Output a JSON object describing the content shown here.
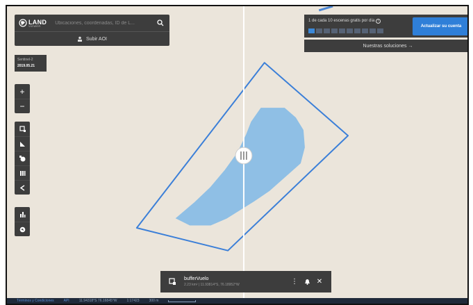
{
  "app": {
    "logo_text": "LAND",
    "logo_subtext": "VIEWER"
  },
  "search": {
    "placeholder": "Ubicaciones, coordenadas, ID de L...",
    "icon": "search-icon",
    "upload_label": "Subir AOI"
  },
  "scene": {
    "satellite": "Sentinel-2",
    "date": "2019.05.21"
  },
  "toolbar": {
    "zoom": [
      "zoom-in-icon",
      "zoom-out-icon"
    ],
    "tools": [
      "aoi-select-icon",
      "measure-icon",
      "time-lapse-icon",
      "compare-icon",
      "share-icon"
    ],
    "analytics": [
      "chart-icon",
      "globe-icon"
    ]
  },
  "quota": {
    "text": "1 de cada 10 escenas gratis por día",
    "used": 1,
    "total": 10,
    "upgrade_label": "Actualizar su cuenta",
    "solutions_label": "Nuestras soluciones →"
  },
  "layer": {
    "name": "bufferVuelo",
    "meta": "2.23 km² | 11.93814°S, 76.18952°W"
  },
  "status": {
    "terms": "Términos y Condiciones",
    "api": "API",
    "coords": "11.94318°S 76.16845°W",
    "scale_ratio": "1:17423",
    "scale_length": "300 m"
  },
  "colors": {
    "map_bg": "#ebe5db",
    "polygon_outline": "#3b7fd8",
    "polygon_fill": "#8fbfe5",
    "panel_bg": "#3d3d3d",
    "accent": "#2f7fd8"
  }
}
